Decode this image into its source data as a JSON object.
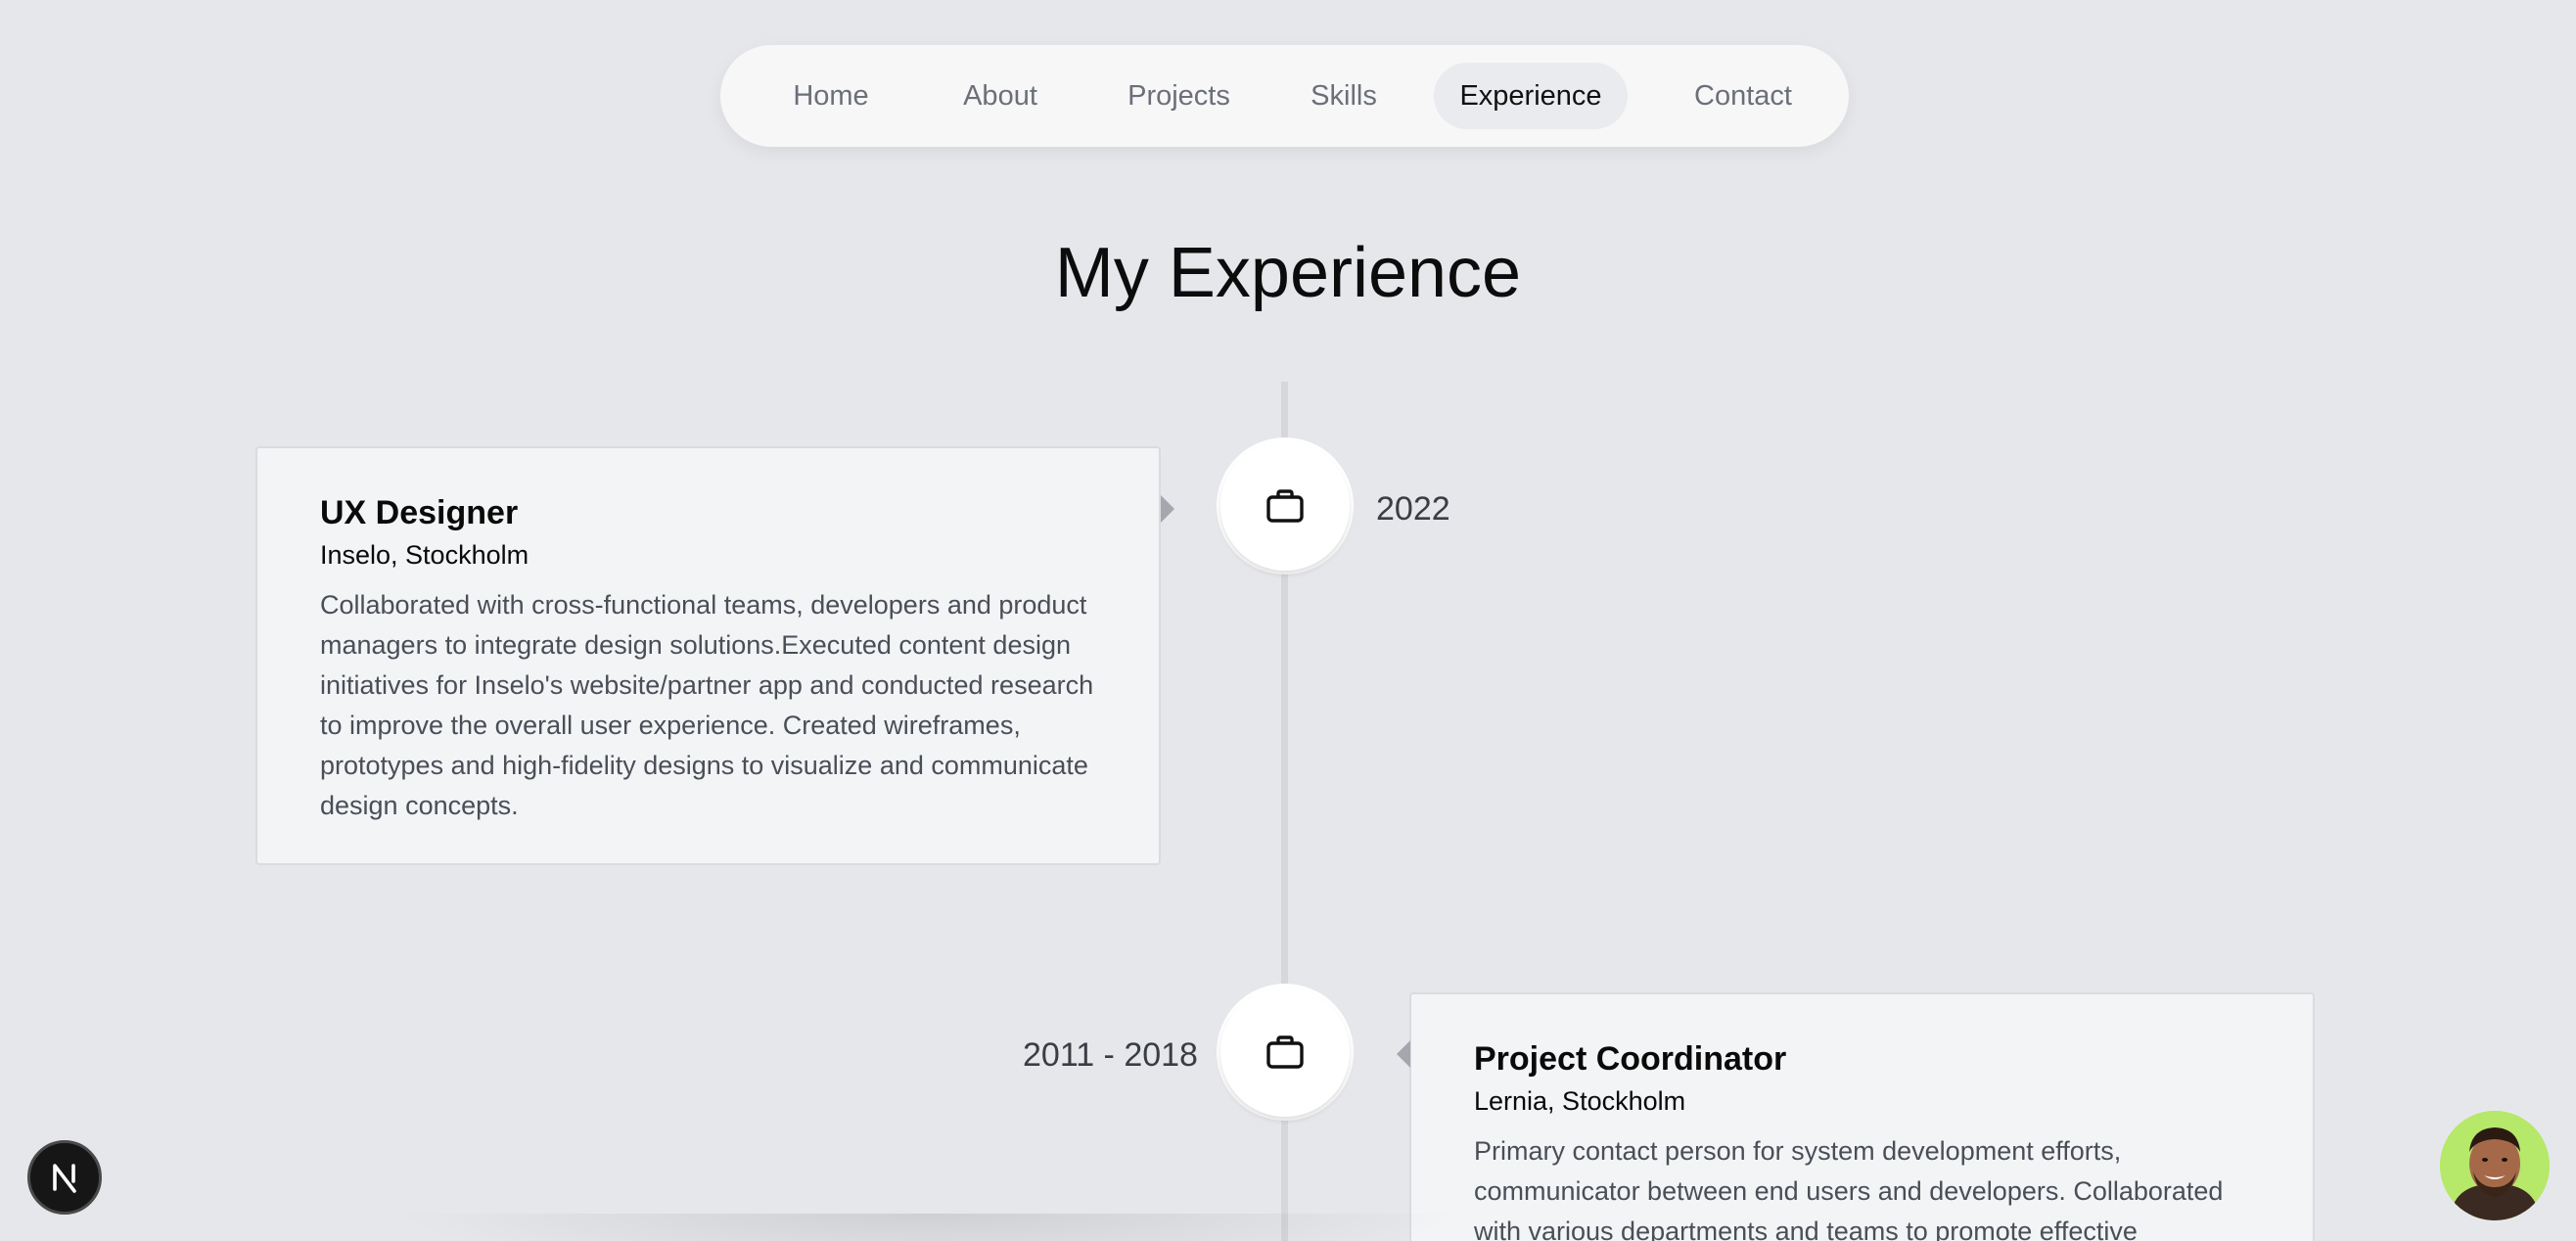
{
  "nav": {
    "items": [
      {
        "label": "Home",
        "active": false
      },
      {
        "label": "About",
        "active": false
      },
      {
        "label": "Projects",
        "active": false
      },
      {
        "label": "Skills",
        "active": false
      },
      {
        "label": "Experience",
        "active": true
      },
      {
        "label": "Contact",
        "active": false
      }
    ]
  },
  "page": {
    "title": "My Experience"
  },
  "experience": [
    {
      "title": "UX Designer",
      "company": "Inselo, Stockholm",
      "description": "Collaborated with cross-functional teams, developers and product managers to integrate design solutions.Executed content design initiatives for Inselo's website/partner app and conducted research to improve the overall user experience. Created wireframes, prototypes and high-fidelity designs to visualize and communicate design concepts.",
      "date": "2022",
      "icon": "briefcase-icon"
    },
    {
      "title": "Project Coordinator",
      "company": "Lernia, Stockholm",
      "description": "Primary contact person for system development efforts, communicator between end users and developers. Collaborated with various departments and teams to promote effective",
      "date": "2011 - 2018",
      "icon": "briefcase-icon"
    }
  ],
  "floating": {
    "framework_badge_icon": "nextjs-logo-icon",
    "avatar_icon": "profile-avatar-icon"
  },
  "colors": {
    "background": "#e6e7eb",
    "card": "#f3f4f6",
    "nav": "#f7f7f8",
    "avatar_bg": "#b6e86a"
  }
}
